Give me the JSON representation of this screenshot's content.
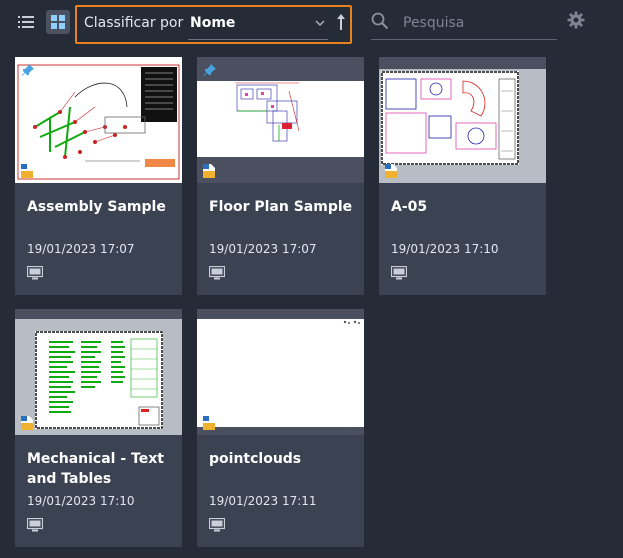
{
  "toolbar": {
    "sort_label": "Classificar por",
    "sort_value": "Nome",
    "search_placeholder": "Pesquisa"
  },
  "icons": {
    "list_view": "list-view-icon",
    "grid_view": "grid-view-icon",
    "sort_direction": "sort-ascending-arrow-icon",
    "search": "search-icon",
    "settings": "gear-icon",
    "pin": "pin-icon",
    "file": "dwg-file-icon",
    "device": "computer-monitor-icon"
  },
  "colors": {
    "background": "#262b38",
    "card": "#3b4252",
    "highlight_border": "#e8821e",
    "pin": "#4aa3e0"
  },
  "files": [
    {
      "title": "Assembly Sample",
      "date": "19/01/2023 17:07",
      "pinned": true
    },
    {
      "title": "Floor Plan Sample",
      "date": "19/01/2023 17:07",
      "pinned": true
    },
    {
      "title": "A-05",
      "date": "19/01/2023 17:10",
      "pinned": false
    },
    {
      "title": "Mechanical - Text and Tables",
      "date": "19/01/2023 17:10",
      "pinned": false
    },
    {
      "title": "pointclouds",
      "date": "19/01/2023 17:11",
      "pinned": false
    }
  ]
}
